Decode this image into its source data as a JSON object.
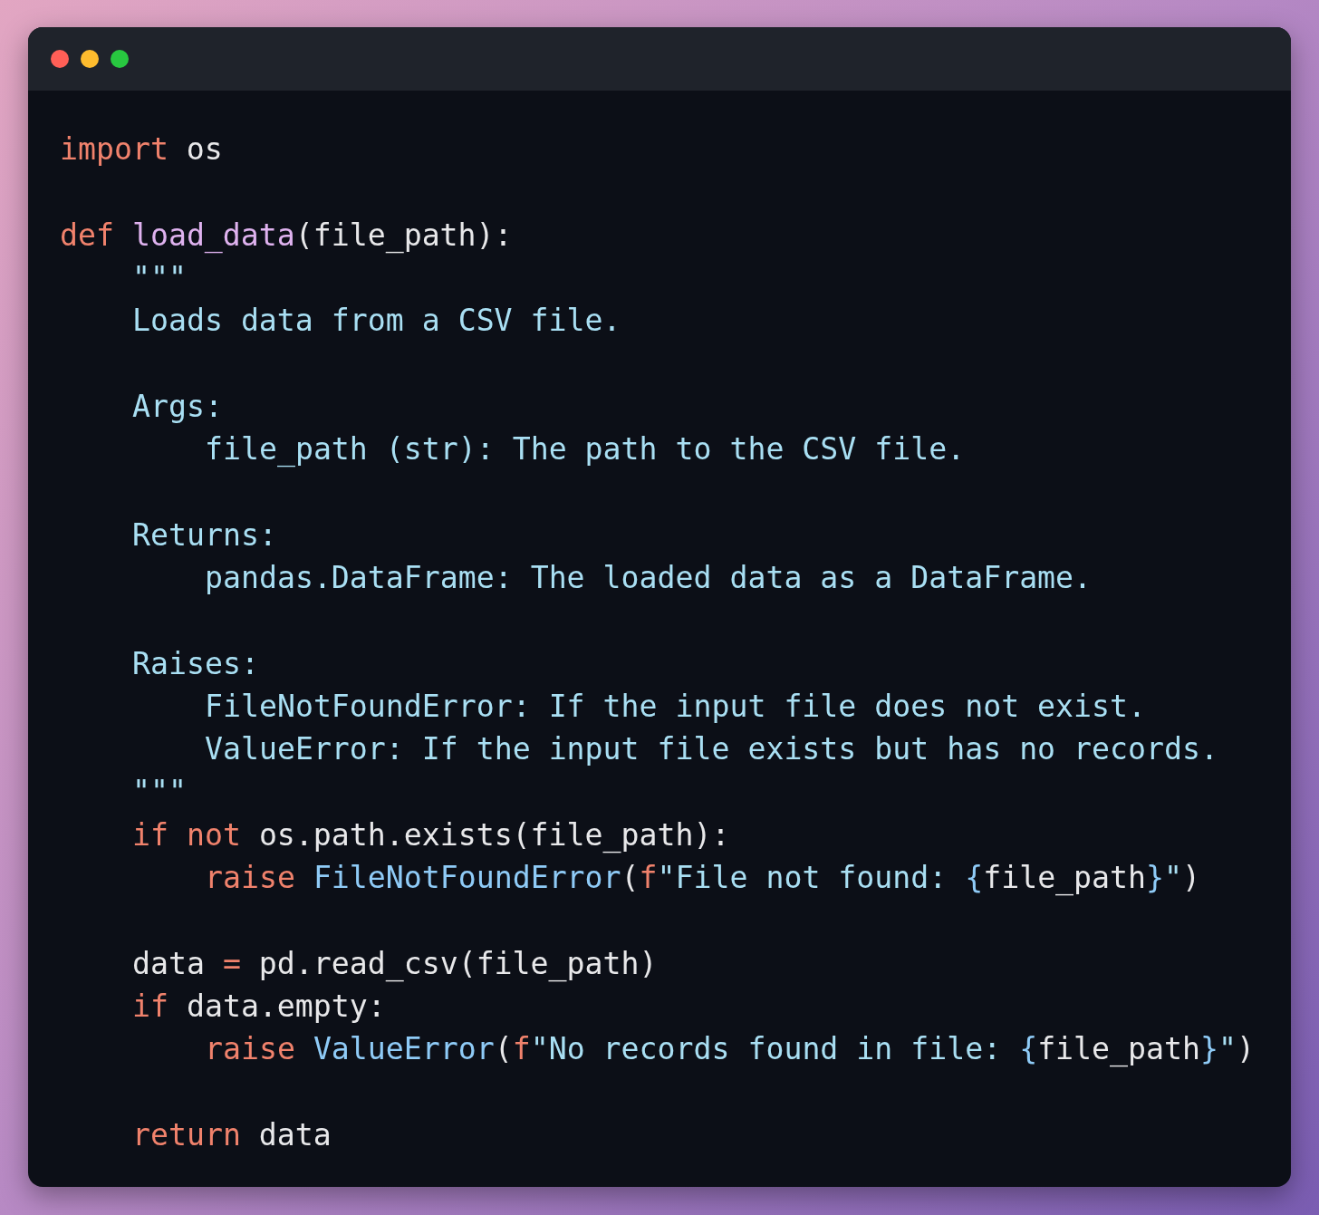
{
  "code": {
    "lines": [
      {
        "tokens": [
          {
            "text": "import",
            "kind": "keyword"
          },
          {
            "text": " os",
            "kind": "plain"
          }
        ]
      },
      {
        "kind": "blank"
      },
      {
        "tokens": [
          {
            "text": "def",
            "kind": "keyword"
          },
          {
            "text": " load_data",
            "kind": "function"
          },
          {
            "text": "(file_path):",
            "kind": "plain"
          }
        ],
        "children": [
          {
            "tokens": [
              {
                "text": "\"\"\"",
                "kind": "docstring"
              }
            ]
          },
          {
            "tokens": [
              {
                "text": "Loads data from a CSV file.",
                "kind": "docstring"
              }
            ]
          },
          {
            "kind": "blank"
          },
          {
            "tokens": [
              {
                "text": "Args:",
                "kind": "docstring"
              }
            ],
            "children": [
              {
                "tokens": [
                  {
                    "text": "file_path (str): The path to the CSV file.",
                    "kind": "docstring"
                  }
                ]
              }
            ]
          },
          {
            "kind": "blank"
          },
          {
            "tokens": [
              {
                "text": "Returns:",
                "kind": "docstring"
              }
            ],
            "children": [
              {
                "tokens": [
                  {
                    "text": "pandas.DataFrame: The loaded data as a DataFrame.",
                    "kind": "docstring"
                  }
                ]
              }
            ]
          },
          {
            "kind": "blank"
          },
          {
            "tokens": [
              {
                "text": "Raises:",
                "kind": "docstring"
              }
            ],
            "children": [
              {
                "tokens": [
                  {
                    "text": "FileNotFoundError: If the input file does not exist.",
                    "kind": "docstring"
                  }
                ]
              },
              {
                "tokens": [
                  {
                    "text": "ValueError: If the input file exists but has no records.",
                    "kind": "docstring"
                  }
                ]
              }
            ]
          },
          {
            "tokens": [
              {
                "text": "\"\"\"",
                "kind": "docstring"
              }
            ]
          },
          {
            "tokens": [
              {
                "text": "if",
                "kind": "keyword"
              },
              {
                "text": " not",
                "kind": "keyword"
              },
              {
                "text": " os.path.exists(file_path):",
                "kind": "plain"
              }
            ],
            "children": [
              {
                "tokens": [
                  {
                    "text": "raise",
                    "kind": "keyword"
                  },
                  {
                    "text": " FileNotFoundError",
                    "kind": "class"
                  },
                  {
                    "text": "(",
                    "kind": "plain"
                  },
                  {
                    "text": "f",
                    "kind": "keyword"
                  },
                  {
                    "text": "\"File not found: ",
                    "kind": "string"
                  },
                  {
                    "text": "{",
                    "kind": "brace"
                  },
                  {
                    "text": "file_path",
                    "kind": "plain"
                  },
                  {
                    "text": "}",
                    "kind": "brace"
                  },
                  {
                    "text": "\"",
                    "kind": "string"
                  },
                  {
                    "text": ")",
                    "kind": "plain"
                  }
                ]
              }
            ]
          },
          {
            "kind": "blank"
          },
          {
            "tokens": [
              {
                "text": "data ",
                "kind": "plain"
              },
              {
                "text": "=",
                "kind": "keyword"
              },
              {
                "text": " pd.read_csv(file_path)",
                "kind": "plain"
              }
            ]
          },
          {
            "tokens": [
              {
                "text": "if",
                "kind": "keyword"
              },
              {
                "text": " data.empty:",
                "kind": "plain"
              }
            ],
            "children": [
              {
                "tokens": [
                  {
                    "text": "raise",
                    "kind": "keyword"
                  },
                  {
                    "text": " ValueError",
                    "kind": "class"
                  },
                  {
                    "text": "(",
                    "kind": "plain"
                  },
                  {
                    "text": "f",
                    "kind": "keyword"
                  },
                  {
                    "text": "\"No records found in file: ",
                    "kind": "string"
                  },
                  {
                    "text": "{",
                    "kind": "brace"
                  },
                  {
                    "text": "file_path",
                    "kind": "plain"
                  },
                  {
                    "text": "}",
                    "kind": "brace"
                  },
                  {
                    "text": "\"",
                    "kind": "string"
                  },
                  {
                    "text": ")",
                    "kind": "plain"
                  }
                ]
              }
            ]
          },
          {
            "kind": "blank"
          },
          {
            "tokens": [
              {
                "text": "return",
                "kind": "keyword"
              },
              {
                "text": " data",
                "kind": "plain"
              }
            ]
          }
        ]
      }
    ]
  }
}
